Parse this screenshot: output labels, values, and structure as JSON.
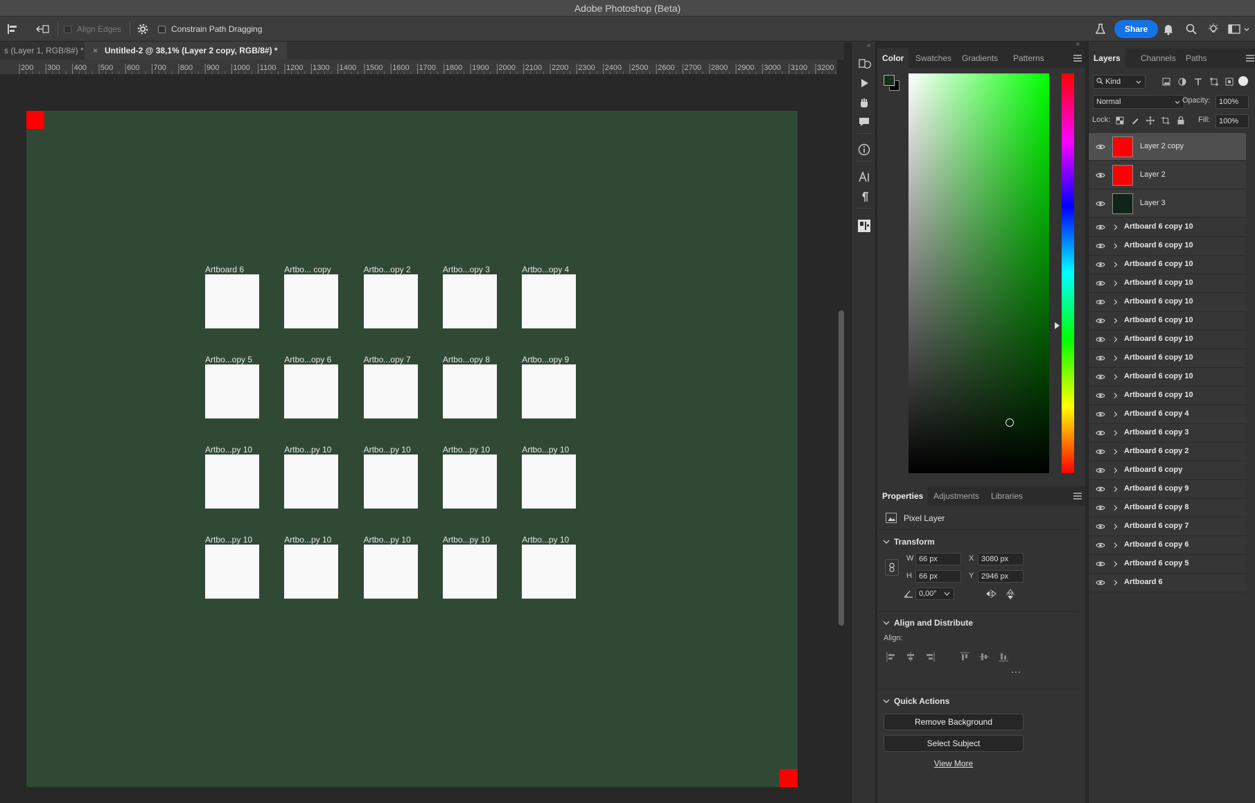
{
  "window": {
    "title": "Adobe Photoshop (Beta)"
  },
  "options_bar": {
    "align_edges": "Align Edges",
    "constrain_path": "Constrain Path Dragging",
    "share": "Share"
  },
  "doc_tabs": [
    {
      "label": "s (Layer 1, RGB/8#) *"
    },
    {
      "label": "Untitled-2 @ 38,1% (Layer 2 copy, RGB/8#) *"
    }
  ],
  "ruler": {
    "ticks": [
      "200",
      "300",
      "400",
      "500",
      "600",
      "700",
      "800",
      "900",
      "1000",
      "1100",
      "1200",
      "1300",
      "1400",
      "1500",
      "1600",
      "1700",
      "1800",
      "1900",
      "2000",
      "2100",
      "2200",
      "2300",
      "2400",
      "2500",
      "2600",
      "2700",
      "2800",
      "2900",
      "3000",
      "3100",
      "3200"
    ]
  },
  "canvas": {
    "artboard_color": "#304935",
    "tiles": [
      [
        "Artboard 6",
        "Artbo... copy",
        "Artbo...opy 2",
        "Artbo...opy 3",
        "Artbo...opy 4"
      ],
      [
        "Artbo...opy 5",
        "Artbo...opy 6",
        "Artbo...opy 7",
        "Artbo...opy 8",
        "Artbo...opy 9"
      ],
      [
        "Artbo...py 10",
        "Artbo...py 10",
        "Artbo...py 10",
        "Artbo...py 10",
        "Artbo...py 10"
      ],
      [
        "Artbo...py 10",
        "Artbo...py 10",
        "Artbo...py 10",
        "Artbo...py 10",
        "Artbo...py 10"
      ]
    ]
  },
  "color_panel": {
    "tabs": [
      "Color",
      "Swatches",
      "Gradients",
      "Patterns"
    ],
    "foreground": "#17301c",
    "background": "#000000",
    "hue_color": "#00ff00"
  },
  "properties_panel": {
    "tabs": [
      "Properties",
      "Adjustments",
      "Libraries"
    ],
    "kind": "Pixel Layer",
    "transform_title": "Transform",
    "w_label": "W",
    "w_value": "66 px",
    "x_label": "X",
    "x_value": "3080 px",
    "h_label": "H",
    "h_value": "66 px",
    "y_label": "Y",
    "y_value": "2946 px",
    "angle": "0,00°",
    "align_title": "Align and Distribute",
    "align_label": "Align:",
    "more": "...",
    "quick_title": "Quick Actions",
    "remove_bg": "Remove Background",
    "select_subject": "Select Subject",
    "view_more": "View More"
  },
  "layers_panel": {
    "tabs": [
      "Layers",
      "Channels",
      "Paths"
    ],
    "filter": "Kind",
    "blend_mode": "Normal",
    "opacity_label": "Opacity:",
    "opacity": "100%",
    "lock_label": "Lock:",
    "fill_label": "Fill:",
    "fill": "100%",
    "pixel_layers": [
      {
        "name": "Layer 2 copy",
        "color": "#ff0000",
        "selected": true
      },
      {
        "name": "Layer 2",
        "color": "#ff0000",
        "selected": false
      },
      {
        "name": "Layer 3",
        "color": "#10251a",
        "selected": false
      }
    ],
    "artboards": [
      "Artboard 6 copy 10",
      "Artboard 6 copy 10",
      "Artboard 6 copy 10",
      "Artboard 6 copy 10",
      "Artboard 6 copy 10",
      "Artboard 6 copy 10",
      "Artboard 6 copy 10",
      "Artboard 6 copy 10",
      "Artboard 6 copy 10",
      "Artboard 6 copy 10",
      "Artboard 6 copy 4",
      "Artboard 6 copy 3",
      "Artboard 6 copy 2",
      "Artboard 6 copy",
      "Artboard 6 copy 9",
      "Artboard 6 copy 8",
      "Artboard 6 copy 7",
      "Artboard 6 copy 6",
      "Artboard 6 copy 5",
      "Artboard 6"
    ]
  }
}
